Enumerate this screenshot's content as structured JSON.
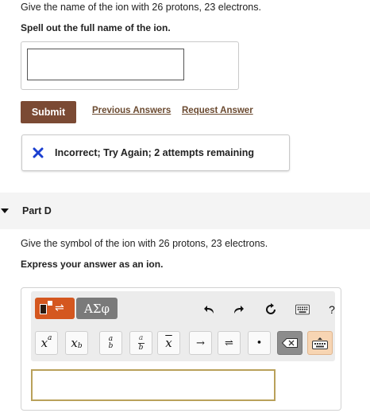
{
  "partC": {
    "question": "Give the name of the ion with 26 protons, 23 electrons.",
    "instruction": "Spell out the full name of the ion.",
    "answer_value": "",
    "submit_label": "Submit",
    "previous_answers_label": "Previous Answers",
    "request_answer_label": "Request Answer",
    "feedback": "Incorrect; Try Again; 2 attempts remaining"
  },
  "partD": {
    "title": "Part D",
    "question": "Give the symbol of the ion with 26 protons, 23 electrons.",
    "instruction": "Express your answer as an ion.",
    "answer_value": ""
  },
  "toolbar": {
    "greek_label": "ΑΣφ",
    "help_label": "?",
    "symbols": {
      "x": "x",
      "sup": "a",
      "sub": "b",
      "frac_a": "a",
      "frac_b": "b",
      "xbar": "x",
      "arrow": "→",
      "eq": "⇌",
      "dot": "•"
    }
  },
  "colors": {
    "submit_bg": "#7b4a34",
    "link": "#6b4a30",
    "incorrect_x": "#1a3fd0",
    "template_btn": "#d4571f",
    "greek_btn": "#7a7a7a",
    "answer_border": "#b9a15a"
  },
  "icons": [
    "close-icon",
    "caret-down-icon",
    "template-icon",
    "undo-icon",
    "redo-icon",
    "reset-icon",
    "keyboard-icon",
    "help-icon",
    "backspace-icon"
  ]
}
